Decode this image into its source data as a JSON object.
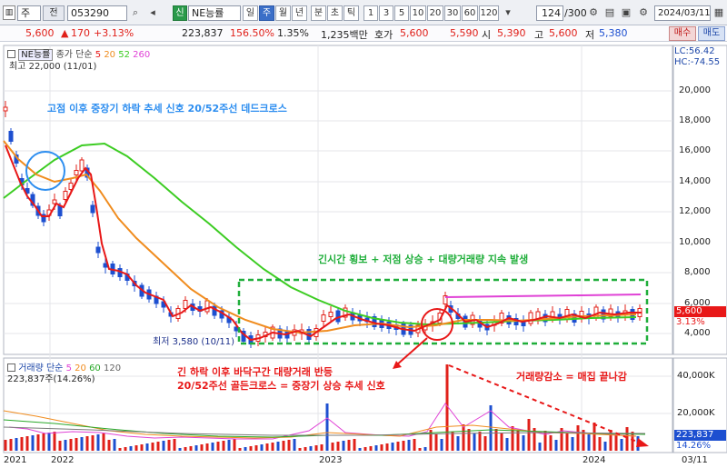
{
  "toolbar": {
    "market": "주",
    "type_btn": "전",
    "code": "053290",
    "credit_badge": "신",
    "name": "NE능률",
    "periods": [
      "일",
      "주",
      "월",
      "년",
      "분",
      "초",
      "틱"
    ],
    "period_active": "주",
    "numbers": [
      "1",
      "3",
      "5",
      "10",
      "20",
      "30",
      "60",
      "120"
    ],
    "count": "124",
    "count_total": "/300",
    "date": "2024/03/11"
  },
  "quote": {
    "price": "5,600",
    "change": "170",
    "change_pct": "+3.13%",
    "volume": "223,837",
    "vol_ratio": "156.50%",
    "turnover": "1.35%",
    "amount": "1,235백만",
    "ask_label": "호가",
    "ask1": "5,600",
    "ask2": "5,590",
    "open_label": "시",
    "open": "5,390",
    "high_label": "고",
    "high": "5,600",
    "low_label": "저",
    "low": "5,380",
    "buy_btn": "매수",
    "sell_btn": "매도"
  },
  "chart_header": {
    "stock": "NE능률",
    "legend_prefix": "종가 단순",
    "ma_periods": [
      "5",
      "20",
      "52",
      "260"
    ],
    "max_label": "최고 22,000 (11/01)",
    "min_label": "최저 3,580 (10/11)",
    "lc": "LC:56.42",
    "hc": "HC:-74.55",
    "price_tag": "5,600",
    "pct_tag": "3.13%"
  },
  "volume_header": {
    "title": "거래량",
    "legend_prefix": "단순",
    "ma_periods": [
      "5",
      "20",
      "60",
      "120"
    ],
    "current": "223,837주(14.26%)",
    "tag_value": "223,837",
    "tag_pct": "14.26%"
  },
  "price_axis": [
    "20,000",
    "18,000",
    "16,000",
    "14,000",
    "12,000",
    "10,000",
    "8,000",
    "6,000",
    "4,000"
  ],
  "volume_axis": [
    "40,000K",
    "20,000K"
  ],
  "x_axis": [
    "2021",
    "2022",
    "2023",
    "2024",
    "03/11"
  ],
  "annotations": {
    "a1": "고점 이후 중장기 하락 추세 신호 20/52주선 데드크로스",
    "a2": "긴시간 횡보 + 저점 상승 + 대량거래량 지속 발생",
    "a3_line1": "긴 하락 이후 바닥구간 대량거래 반등",
    "a3_line2": "20/52주선 골든크로스 = 중장기 상승 추세 신호",
    "a4": "거래량감소 = 매집 끝나감"
  },
  "colors": {
    "ma5": "#e81818",
    "ma20": "#f08c1e",
    "ma52": "#3ccc22",
    "ma260": "#e042d6",
    "up": "#e0201a",
    "down": "#1d4fd0"
  }
}
